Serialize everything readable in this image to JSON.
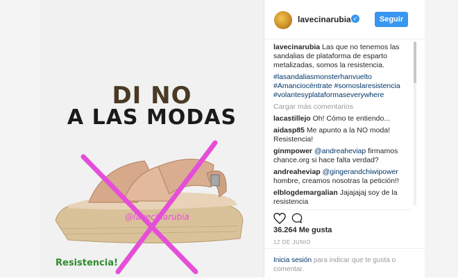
{
  "post": {
    "headline_line1": "DI NO",
    "headline_line2": "A LAS MODAS",
    "watermark": "@lavecinarubia",
    "corner_text": "Resistencia!",
    "accent_pink": "#e54fd8",
    "accent_green": "#2e8a2f"
  },
  "header": {
    "username": "lavecinarubia",
    "verified_icon": "verified-badge-icon",
    "follow_label": "Seguir"
  },
  "caption": {
    "user": "lavecinarubia",
    "text": "Las que no tenemos las sandalias de plataforma de esparto metalizadas, somos la resistencia.",
    "tags": [
      "#lasandaliasmonsterhanvuelto",
      "#Amanciocéntrate #somoslaresistencia",
      "#volantesyplataformaseverywhere"
    ]
  },
  "load_more": "Cargar más comentarios",
  "comments": [
    {
      "user": "lacastillejo",
      "text": "Oh! Cómo te entiendo..."
    },
    {
      "user": "aidasp85",
      "text": "Me apunto a la NO moda! Resistencia!"
    },
    {
      "user": "ginmpower",
      "mention": "@andreaheviap",
      "text": "firmamos chance.org si hace falta verdad?"
    },
    {
      "user": "andreaheviap",
      "mention": "@gingerandchiwipower",
      "text": "hombre, creamos nosotras la petición!!"
    },
    {
      "user": "elblogdemargalian",
      "text": "Jajajajaj soy de la resistencia"
    }
  ],
  "actions": {
    "like_icon": "heart-icon",
    "comment_icon": "comment-bubble-icon"
  },
  "likes": "36.264 Me gusta",
  "date": "12 DE JUNIO",
  "login": {
    "link": "Inicia sesión",
    "text": "para indicar que te gusta o comentar."
  },
  "colors": {
    "link_blue": "#003569",
    "button_blue": "#3897f0"
  }
}
